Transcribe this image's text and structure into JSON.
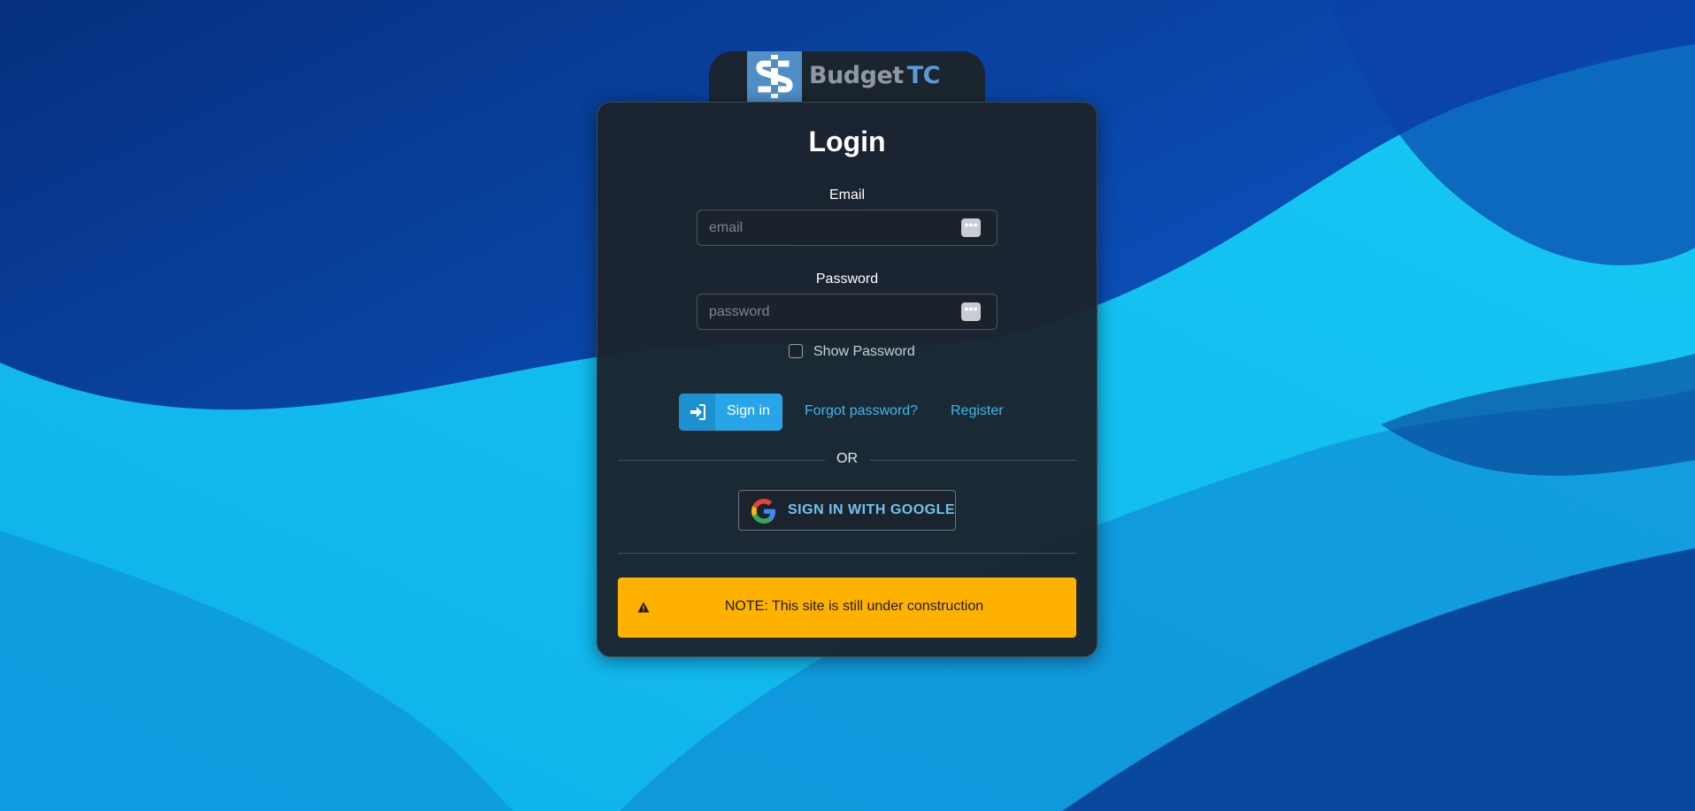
{
  "brand": {
    "name_part1": "Budget",
    "name_part2": "TC",
    "logo_icon": "dollar-sign-icon"
  },
  "login": {
    "title": "Login",
    "email_label": "Email",
    "email_placeholder": "email",
    "password_label": "Password",
    "password_placeholder": "password",
    "show_password_label": "Show Password",
    "show_password_checked": false,
    "signin_label": "Sign in",
    "signin_icon": "sign-in-icon",
    "forgot_label": "Forgot password?",
    "register_label": "Register",
    "or_label": "OR",
    "google_label": "SIGN IN WITH GOOGLE",
    "google_icon": "google-icon"
  },
  "notice": {
    "text": "NOTE: This site is still under construction",
    "icon": "warning-icon"
  },
  "colors": {
    "accent": "#27a5e8",
    "link": "#3fb7ef",
    "warning": "#ffb100",
    "card": "#1b232c"
  }
}
